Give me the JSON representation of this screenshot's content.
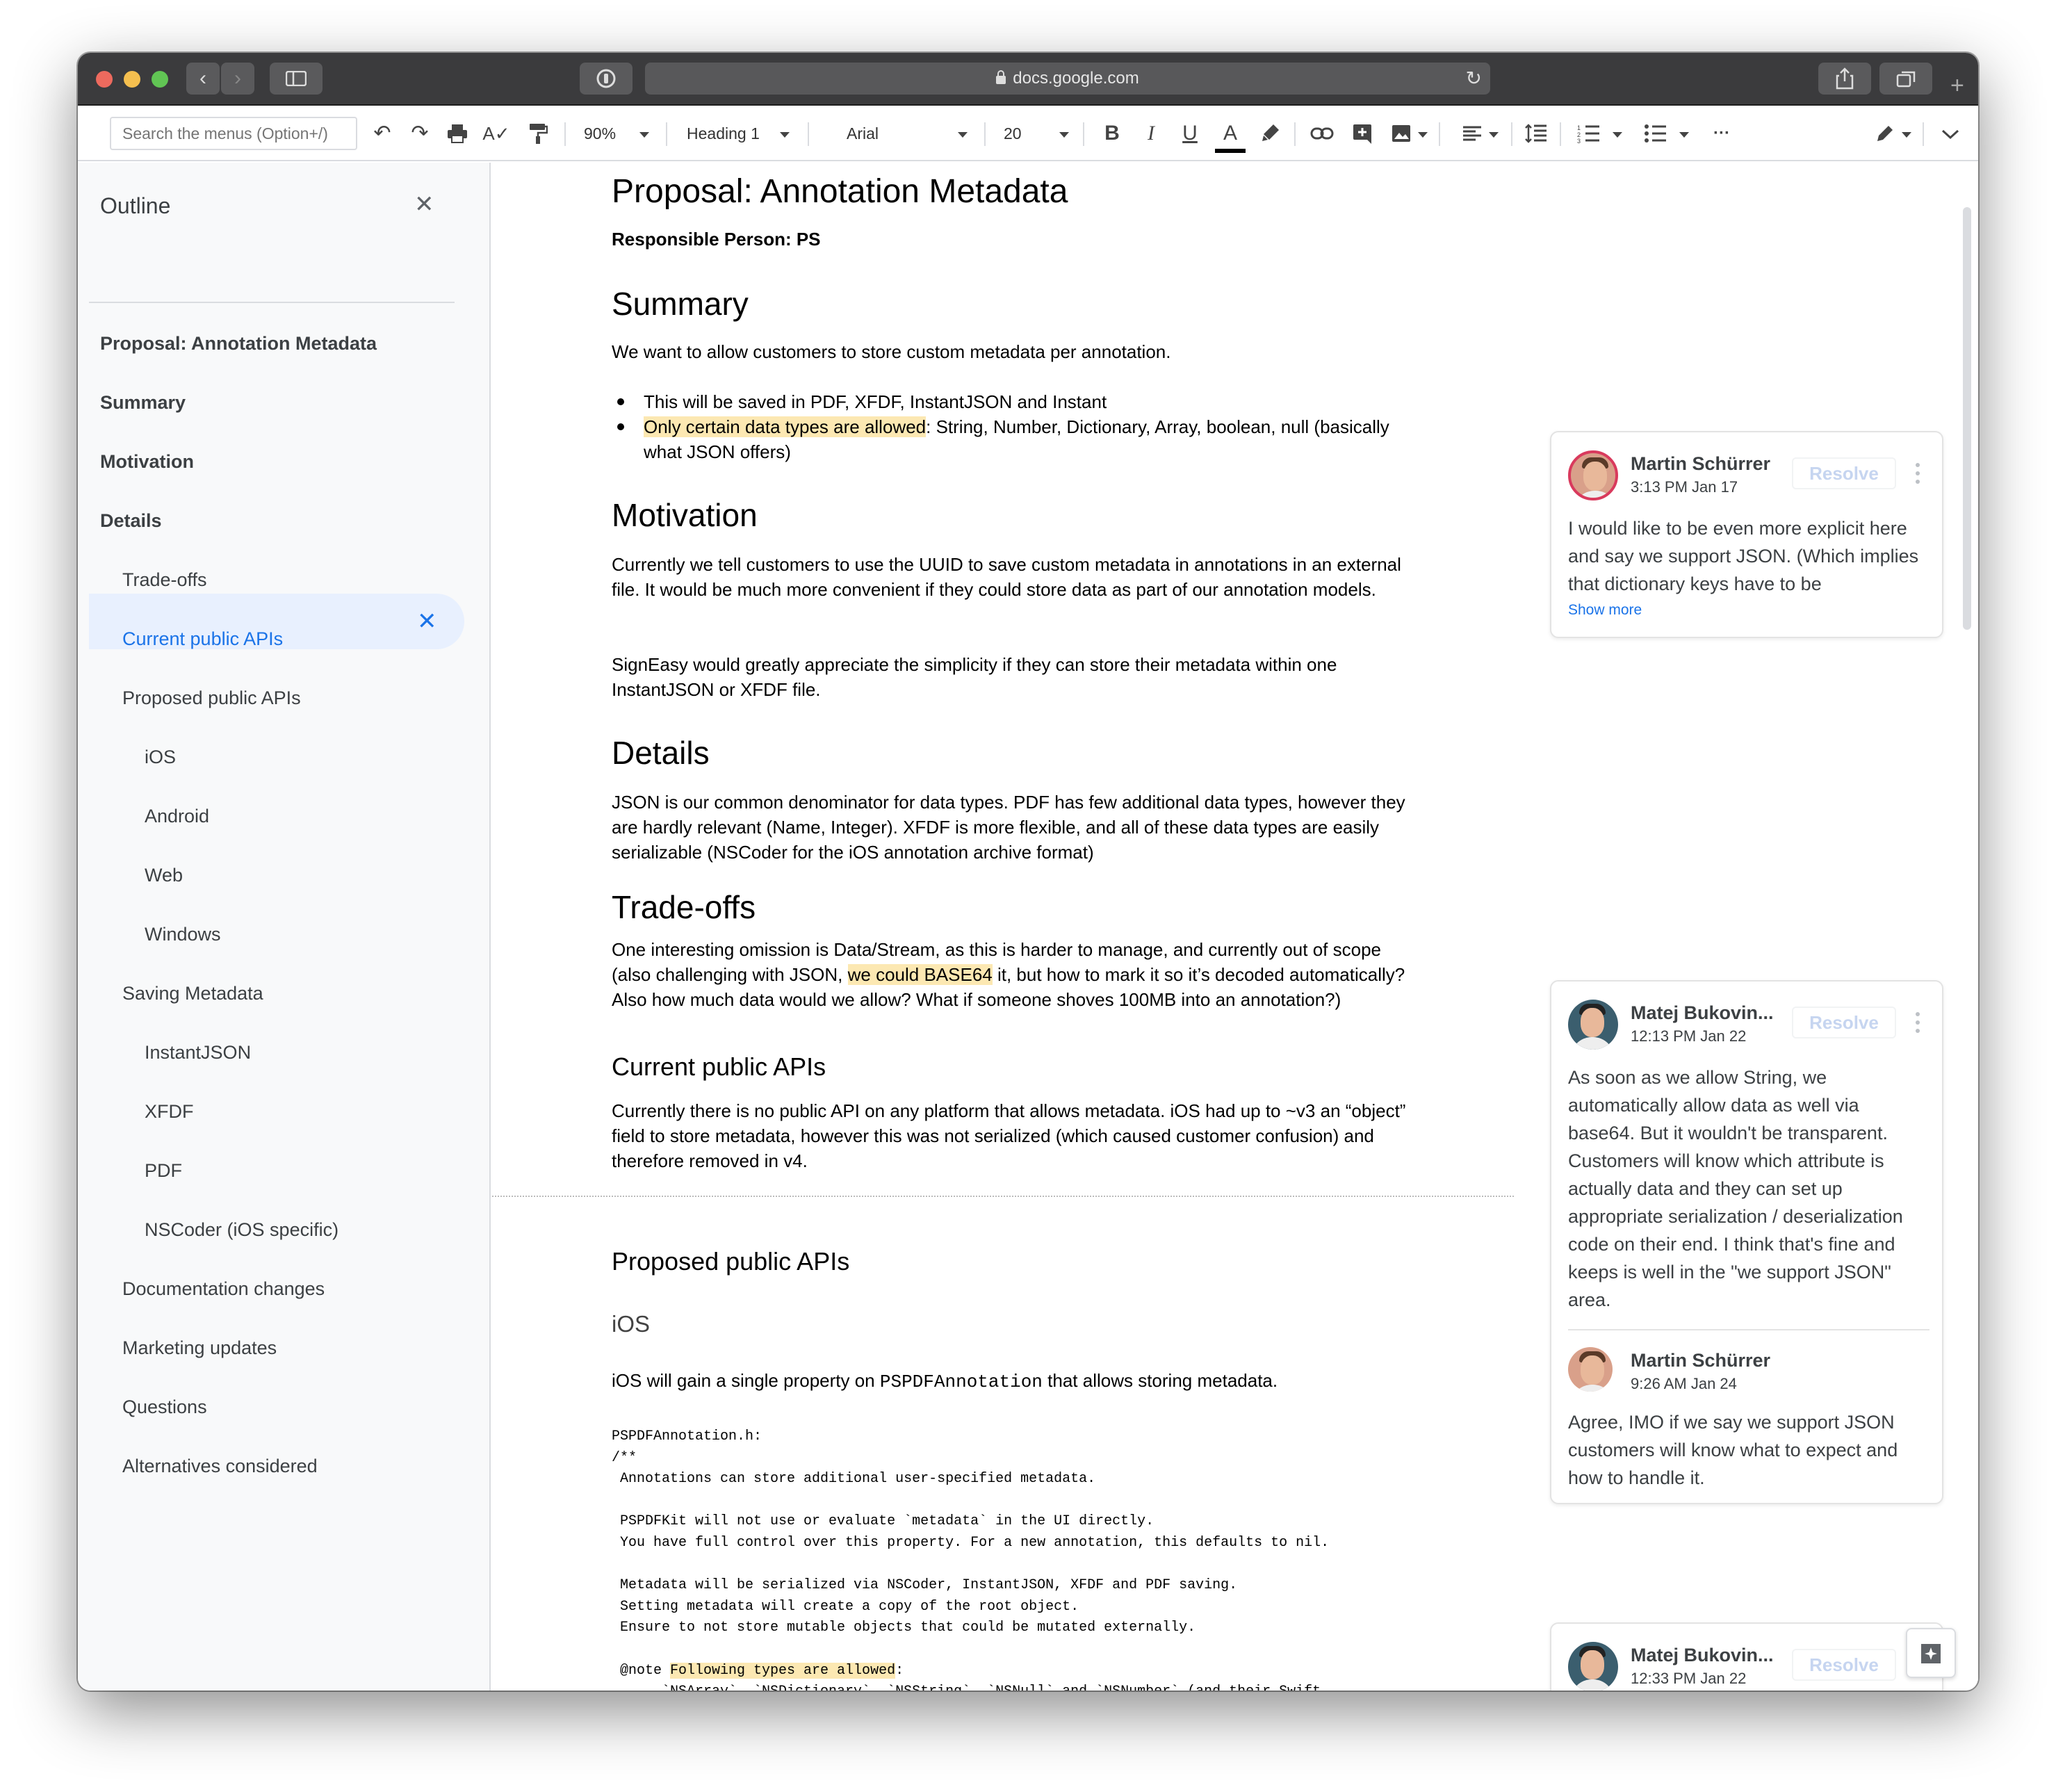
{
  "browser": {
    "url": "docs.google.com",
    "reload_icon": "reload-icon",
    "share_icon": "share-icon",
    "tabs_icon": "tabs-icon",
    "new_tab_label": "+",
    "back_icon": "chevron-left-icon",
    "forward_icon": "chevron-right-icon",
    "sidebar_icon": "sidebar-icon"
  },
  "toolbar": {
    "search_placeholder": "Search the menus (Option+/)",
    "zoom": "90%",
    "style": "Heading 1",
    "font": "Arial",
    "font_size": "20",
    "bold_label": "B",
    "italic_label": "I",
    "underline_label": "U",
    "text_color_label": "A",
    "more_label": "···"
  },
  "outline": {
    "title": "Outline",
    "items": [
      {
        "label": "Proposal: Annotation Metadata",
        "level": 1
      },
      {
        "label": "Summary",
        "level": 1
      },
      {
        "label": "Motivation",
        "level": 1
      },
      {
        "label": "Details",
        "level": 1
      },
      {
        "label": "Trade-offs",
        "level": 2
      },
      {
        "label": "Current public APIs",
        "level": 2,
        "active": true
      },
      {
        "label": "Proposed public APIs",
        "level": 2
      },
      {
        "label": "iOS",
        "level": 3
      },
      {
        "label": "Android",
        "level": 3
      },
      {
        "label": "Web",
        "level": 3
      },
      {
        "label": "Windows",
        "level": 3
      },
      {
        "label": "Saving Metadata",
        "level": 2
      },
      {
        "label": "InstantJSON",
        "level": 3
      },
      {
        "label": "XFDF",
        "level": 3
      },
      {
        "label": "PDF",
        "level": 3
      },
      {
        "label": "NSCoder (iOS specific)",
        "level": 3
      },
      {
        "label": "Documentation changes",
        "level": 2
      },
      {
        "label": "Marketing updates",
        "level": 2
      },
      {
        "label": "Questions",
        "level": 2
      },
      {
        "label": "Alternatives considered",
        "level": 2
      }
    ]
  },
  "doc": {
    "title": "Proposal: Annotation Metadata",
    "responsible": "Responsible Person: PS",
    "summary_heading": "Summary",
    "summary_text": "We want to allow customers to store custom metadata per annotation.",
    "bullet_1": "This will be saved in PDF, XFDF, InstantJSON and Instant",
    "bullet_2_hl": "Only certain data types are allowed",
    "bullet_2_rest": ": String, Number, Dictionary, Array, boolean, null (basically what JSON offers)",
    "motivation_heading": "Motivation",
    "motivation_p1": "Currently we tell customers to use the UUID to save custom metadata in annotations in an external file. It would be much more convenient if they could store data as part of our annotation models.",
    "motivation_p2": "SignEasy would greatly appreciate the simplicity if they can store their metadata within one InstantJSON or XFDF file.",
    "details_heading": "Details",
    "details_p": "JSON is our common denominator for data types. PDF has few additional data types, however they are hardly relevant (Name, Integer). XFDF is more flexible, and all of these data types are easily serializable (NSCoder for the iOS annotation archive format)",
    "tradeoffs_heading": "Trade-offs",
    "tradeoffs_a": "One interesting omission is Data/Stream, as this is harder to manage, and currently out of scope (also challenging with JSON, ",
    "tradeoffs_hl": "we could BASE64",
    "tradeoffs_b": " it, but how to mark it so it’s decoded automatically? Also how much data would we allow? What if someone shoves 100MB into an annotation?)",
    "current_heading": "Current public APIs",
    "current_p": "Currently there is no public API on any platform that allows metadata. iOS had up to ~v3 an “object” field to store metadata, however this was not serialized (which caused customer confusion) and therefore removed in v4.",
    "proposed_heading": "Proposed public APIs",
    "ios_heading": "iOS",
    "ios_p_a": "iOS will gain a single property on ",
    "ios_p_code": "PSPDFAnnotation",
    "ios_p_b": " that allows storing metadata.",
    "code_1": "PSPDFAnnotation.h:\n/**\n Annotations can store additional user-specified metadata.\n\n PSPDFKit will not use or evaluate `metadata` in the UI directly.\n You have full control over this property. For a new annotation, this defaults to nil.\n\n Metadata will be serialized via NSCoder, InstantJSON, XFDF and PDF saving.\n Setting metadata will create a copy of the root object.\n Ensure to not store mutable objects that could be mutated externally.\n\n @note ",
    "code_hl": "Following types are allowed",
    "code_2": ":\n      `NSArray`, `NSDictionary`, `NSString`, `NSNull` and `NSNumber` (and their Swift\nequivalents)\n        For `NSNumber` we use `kCFBooleanTrue` and `kCFBooleanFalse` to indicate"
  },
  "comments": [
    {
      "author": "Martin Schürrer",
      "time": "3:13 PM Jan 17",
      "resolve": "Resolve",
      "text": "I would like to be even more explicit here and say we support JSON. (Which implies that dictionary keys have to be",
      "show_more": "Show more"
    },
    {
      "author": "Matej Bukovin...",
      "time": "12:13 PM Jan 22",
      "resolve": "Resolve",
      "text": "As soon as we allow String, we automatically allow data as well via base64. But it wouldn't be transparent. Customers will know which attribute is actually data and they can set up appropriate serialization / deserialization code on their end. I think that's fine and keeps is well in the \"we support JSON\" area.",
      "reply_author": "Martin Schürrer",
      "reply_time": "9:26 AM Jan 24",
      "reply_text": "Agree, IMO if we say we support JSON customers will know what to expect and how to handle it."
    },
    {
      "author": "Matej Bukovin...",
      "time": "12:33 PM Jan 22",
      "resolve": "Resolve"
    }
  ],
  "colors": {
    "highlight": "#fce8b2",
    "accent": "#1a73e8",
    "active_outline": "#e8f0fe"
  }
}
